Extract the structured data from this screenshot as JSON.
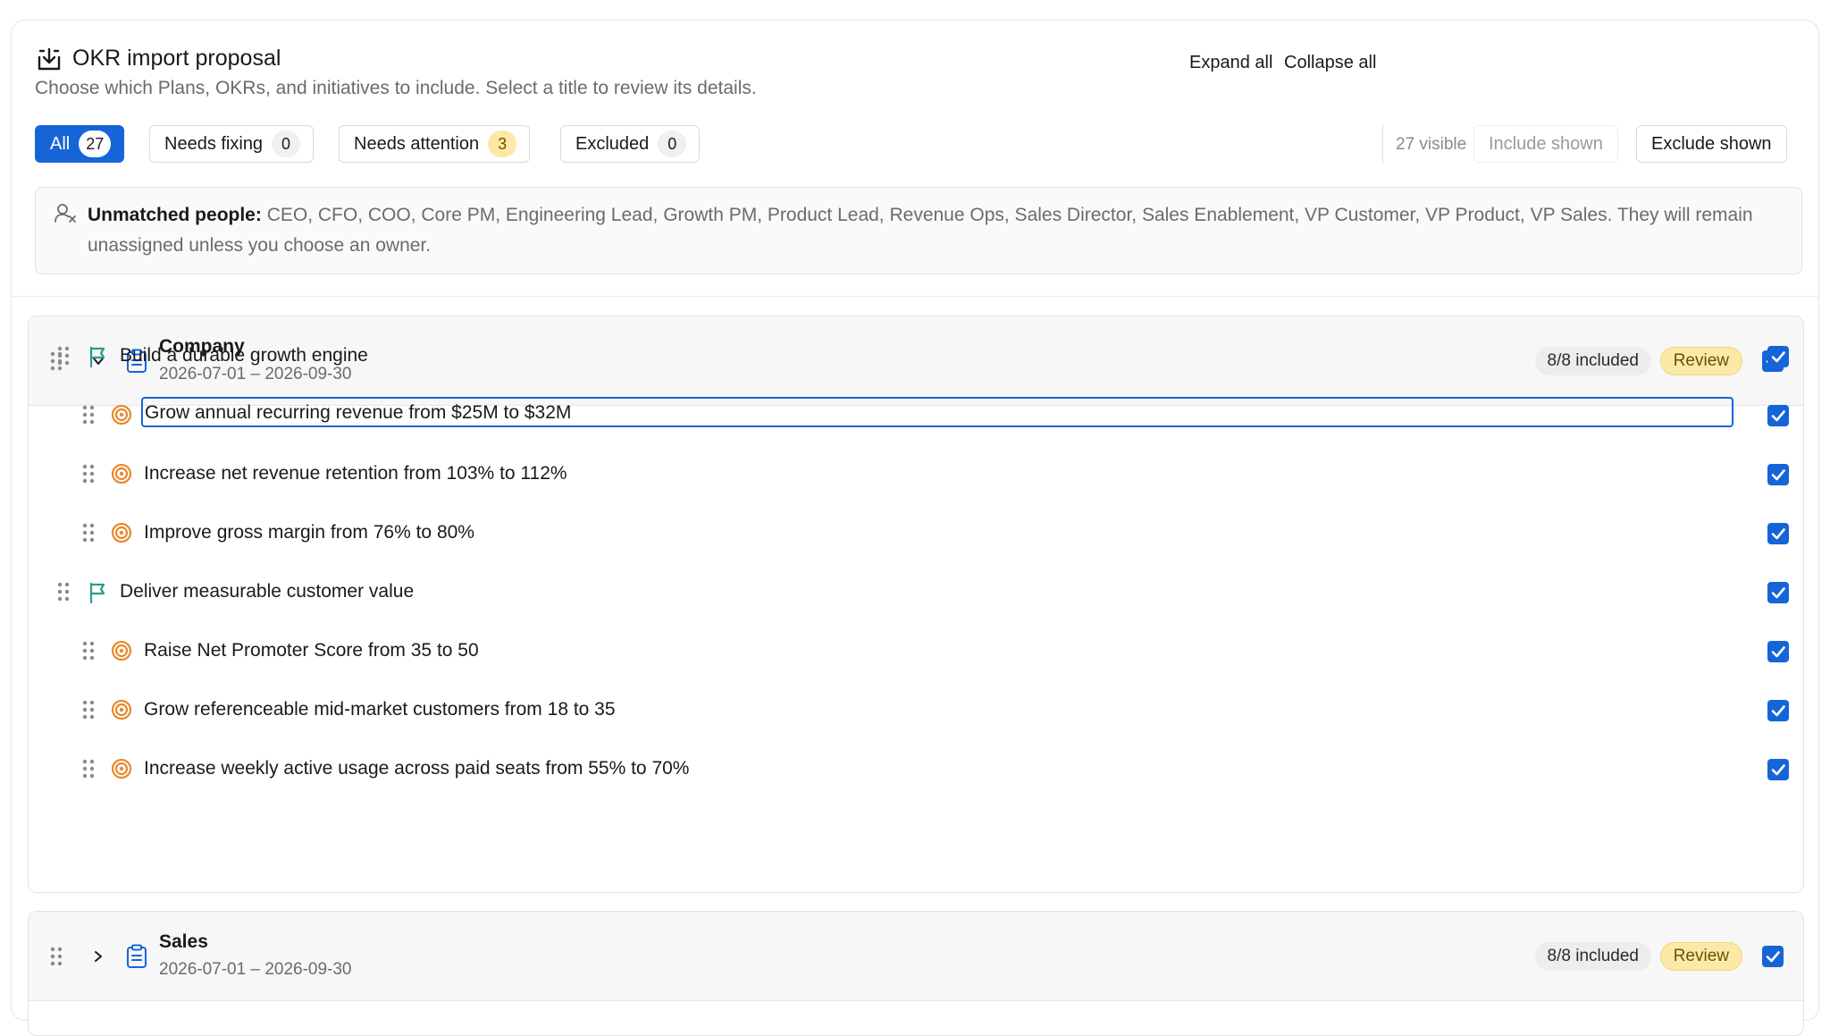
{
  "header": {
    "title": "OKR import proposal",
    "subtitle": "Choose which Plans, OKRs, and initiatives to include. Select a title to review its details.",
    "expand_all": "Expand all",
    "collapse_all": "Collapse all"
  },
  "filters": [
    {
      "label": "All",
      "count": "27",
      "active": true
    },
    {
      "label": "Needs fixing",
      "count": "0"
    },
    {
      "label": "Needs attention",
      "count": "3"
    },
    {
      "label": "Excluded",
      "count": "0"
    }
  ],
  "visible_count": "27 visible",
  "include_shown": "Include shown",
  "exclude_shown": "Exclude shown",
  "unmatched": {
    "label": "Unmatched people:",
    "text": " CEO, CFO, COO, Core PM, Engineering Lead, Growth PM, Product Lead, Revenue Ops, Sales Director, Sales Enablement, VP Customer, VP Product, VP Sales. They will remain unassigned unless you choose an owner."
  },
  "groups": [
    {
      "title": "Company",
      "dates": "2026-07-01 – 2026-09-30",
      "included": "8/8 included",
      "status": "Review",
      "expanded": true,
      "items": [
        {
          "type": "objective",
          "text": "Build a durable growth engine"
        },
        {
          "type": "key_result",
          "text": "Grow annual recurring revenue from $25M to $32M"
        },
        {
          "type": "key_result",
          "text": "Increase net revenue retention from 103% to 112%"
        },
        {
          "type": "key_result",
          "text": "Improve gross margin from 76% to 80%"
        },
        {
          "type": "objective",
          "text": "Deliver measurable customer value"
        },
        {
          "type": "key_result",
          "text": "Raise Net Promoter Score from 35 to 50"
        },
        {
          "type": "key_result",
          "text": "Grow referenceable mid-market customers from 18 to 35"
        },
        {
          "type": "key_result",
          "text": "Increase weekly active usage across paid seats from 55% to 70%"
        }
      ]
    },
    {
      "title": "Sales",
      "dates": "2026-07-01 – 2026-09-30",
      "included": "8/8 included",
      "status": "Review",
      "expanded": false
    }
  ],
  "colors": {
    "accent": "#1565d8",
    "review_bg": "#fbe9a8",
    "objective_icon": "#2a9d8f",
    "key_result_icon": "#e8892b"
  }
}
